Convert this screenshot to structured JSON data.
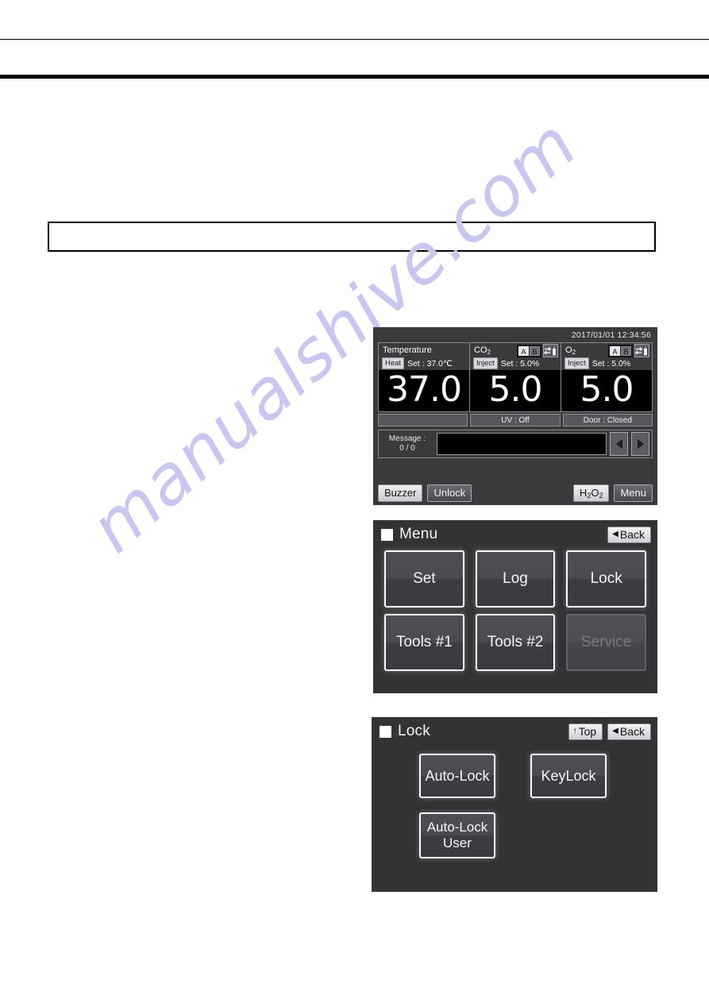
{
  "page": {
    "watermark": "manualshive.com",
    "note_box_text": ""
  },
  "status_screen": {
    "datetime": "2017/01/01  12:34:56",
    "cells": [
      {
        "name": "Temperature",
        "chip": "Heat",
        "set_text": "Set : 37.0℃",
        "value": "37.0",
        "has_ab": false
      },
      {
        "name": "CO",
        "name_sub": "2",
        "chip": "Inject",
        "set_text": "Set :  5.0%",
        "value": "5.0",
        "has_ab": true,
        "ab": {
          "a": "A",
          "b": "B",
          "selected": "A"
        }
      },
      {
        "name": "O",
        "name_sub": "2",
        "chip": "Inject",
        "set_text": "Set :  5.0%",
        "value": "5.0",
        "has_ab": true,
        "ab": {
          "a": "A",
          "b": "B",
          "selected": "A"
        }
      }
    ],
    "subbars": [
      "",
      "UV : Off",
      "Door : Closed"
    ],
    "message": {
      "label": "Message :",
      "counter": "0 / 0",
      "field_value": ""
    },
    "nav": {
      "prev_icon": "triangle-left-icon",
      "next_icon": "triangle-right-icon"
    },
    "bottom_keys": {
      "buzzer": "Buzzer",
      "unlock": "Unlock",
      "h2o2_main": "H",
      "h2o2_sub1": "2",
      "h2o2_mid": "O",
      "h2o2_sub2": "2",
      "menu": "Menu"
    }
  },
  "menu_screen": {
    "title": "Menu",
    "back_label": "Back",
    "back_glyph": "◀",
    "tiles": [
      {
        "label": "Set",
        "disabled": false
      },
      {
        "label": "Log",
        "disabled": false
      },
      {
        "label": "Lock",
        "disabled": false
      },
      {
        "label": "Tools #1",
        "disabled": false
      },
      {
        "label": "Tools #2",
        "disabled": false
      },
      {
        "label": "Service",
        "disabled": true
      }
    ]
  },
  "lock_screen": {
    "title": "Lock",
    "top_label": "Top",
    "top_glyph": "↑",
    "back_label": "Back",
    "back_glyph": "◀",
    "tiles": [
      {
        "label": "Auto-Lock"
      },
      {
        "label": "KeyLock"
      },
      {
        "label": "Auto-Lock\nUser"
      }
    ]
  },
  "colors": {
    "panel_bg": "#333336",
    "readout_bg": "#000000",
    "key_light": "#e8e8ec",
    "watermark": "#c9c7ef"
  }
}
